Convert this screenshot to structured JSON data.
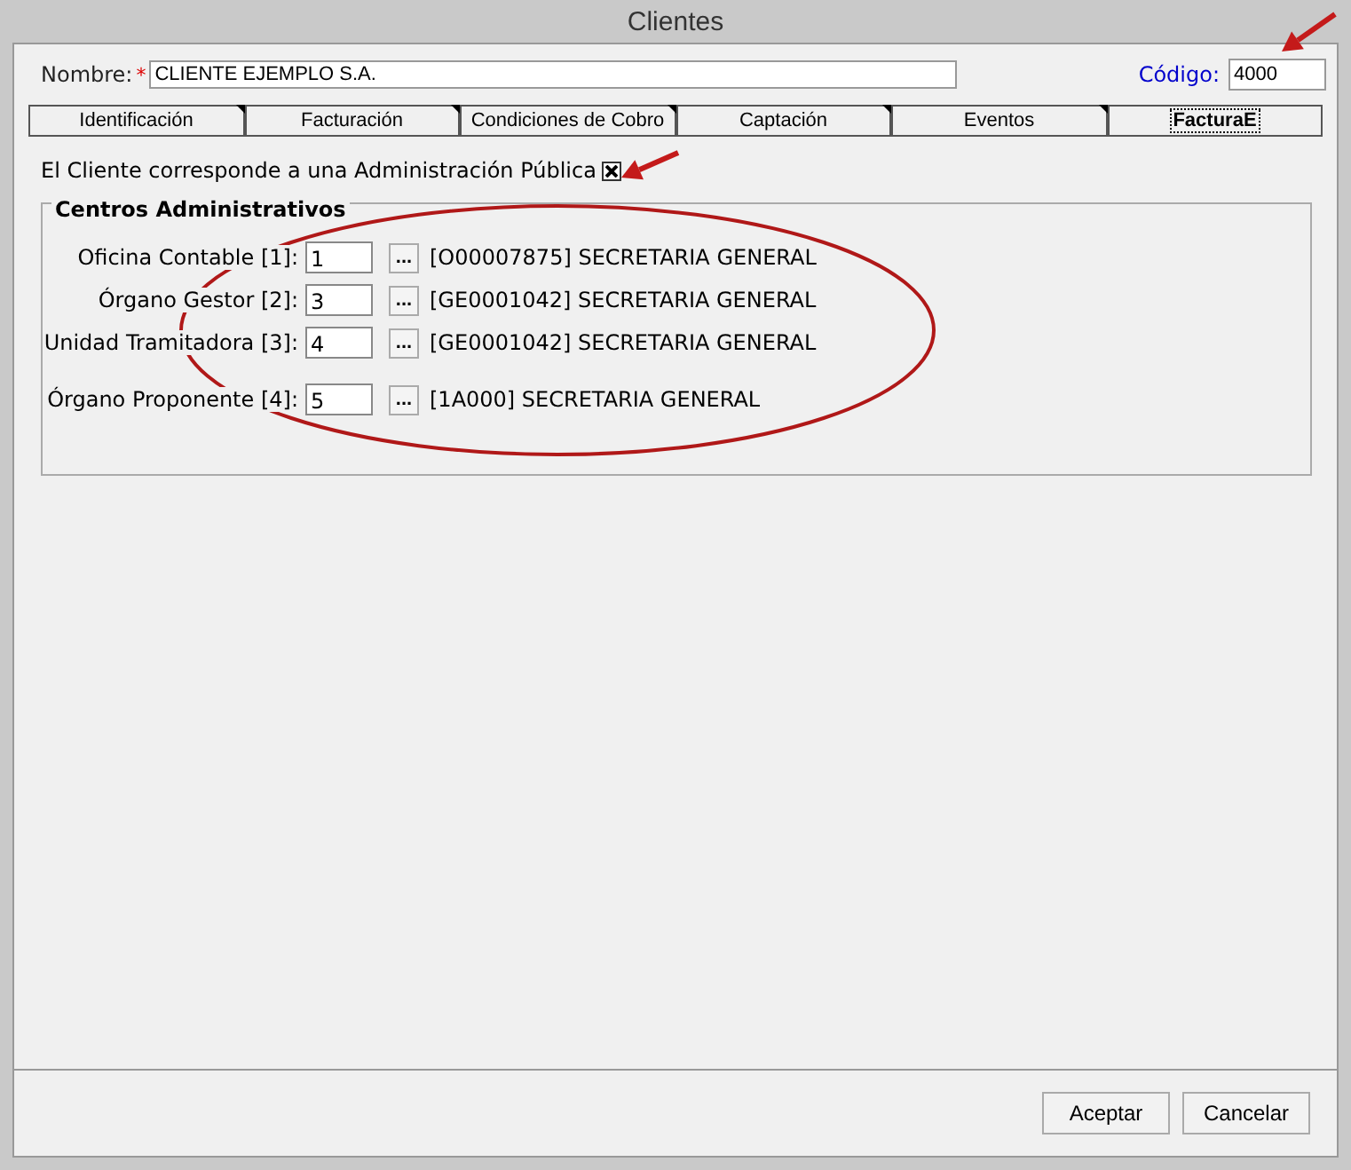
{
  "window": {
    "title": "Clientes"
  },
  "nombre": {
    "label": "Nombre:",
    "required_mark": "*",
    "value": "CLIENTE EJEMPLO S.A."
  },
  "codigo": {
    "label": "Código:",
    "value": "4000"
  },
  "tabs": [
    {
      "label": "Identificación",
      "selected": false
    },
    {
      "label": "Facturación",
      "selected": false
    },
    {
      "label": "Condiciones de Cobro",
      "selected": false
    },
    {
      "label": "Captación",
      "selected": false
    },
    {
      "label": "Eventos",
      "selected": false
    },
    {
      "label": "FacturaE",
      "selected": true
    }
  ],
  "admin_publica": {
    "label": "El Cliente corresponde a una Administración Pública",
    "checked": true
  },
  "group": {
    "title": "Centros Administrativos",
    "rows": [
      {
        "label": "Oficina Contable [1]:",
        "value": "1",
        "button": "...",
        "description": "[O00007875] SECRETARIA GENERAL"
      },
      {
        "label": "Órgano Gestor [2]:",
        "value": "3",
        "button": "...",
        "description": "[GE0001042] SECRETARIA GENERAL"
      },
      {
        "label": "Unidad Tramitadora [3]:",
        "value": "4",
        "button": "...",
        "description": "[GE0001042] SECRETARIA GENERAL"
      },
      {
        "label": "Órgano Proponente [4]:",
        "value": "5",
        "button": "...",
        "description": "[1A000] SECRETARIA GENERAL"
      }
    ]
  },
  "buttons": [
    "Aceptar",
    "Cancelar"
  ]
}
